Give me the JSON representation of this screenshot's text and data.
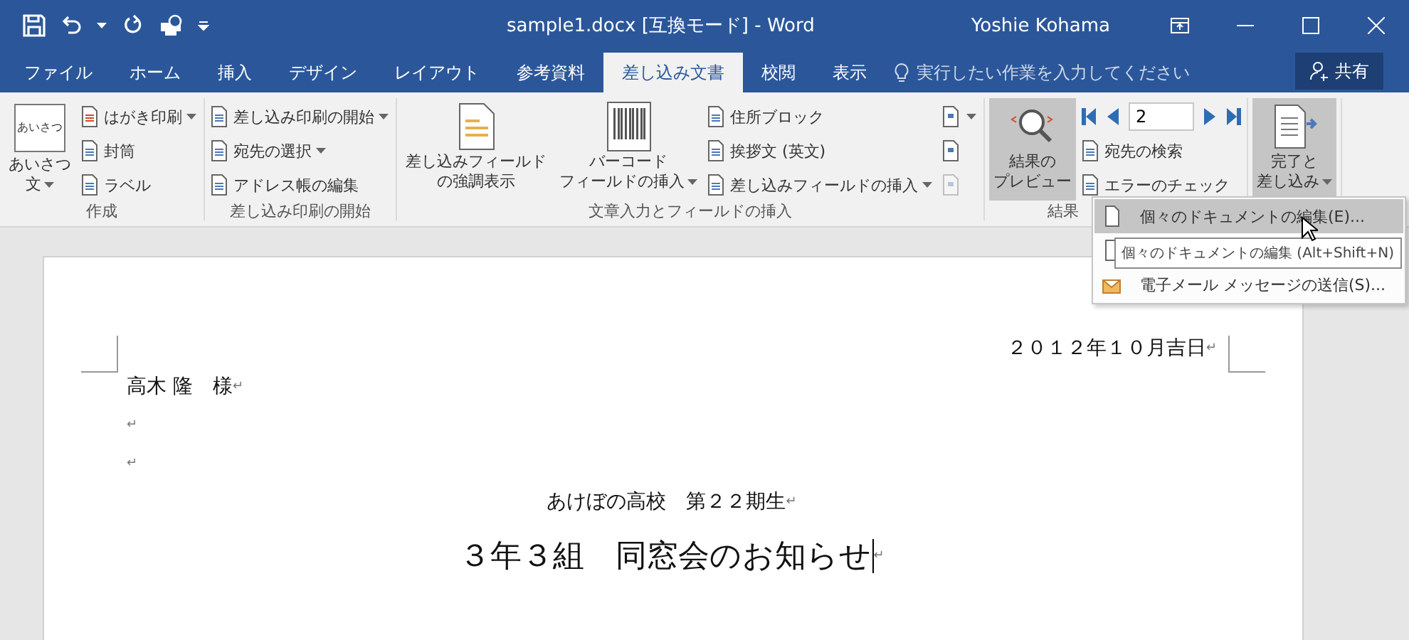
{
  "window": {
    "title": "sample1.docx [互換モード] - Word",
    "user": "Yoshie Kohama"
  },
  "quick_access": [
    {
      "kind": "save"
    },
    {
      "kind": "undo",
      "dropdown": true
    },
    {
      "kind": "redo"
    },
    {
      "kind": "touch"
    },
    {
      "kind": "customize"
    }
  ],
  "tabs": [
    {
      "label": "ファイル",
      "selected": false
    },
    {
      "label": "ホーム",
      "selected": false
    },
    {
      "label": "挿入",
      "selected": false
    },
    {
      "label": "デザイン",
      "selected": false
    },
    {
      "label": "レイアウト",
      "selected": false
    },
    {
      "label": "参考資料",
      "selected": false
    },
    {
      "label": "差し込み文書",
      "selected": true
    },
    {
      "label": "校閲",
      "selected": false
    },
    {
      "label": "表示",
      "selected": false
    }
  ],
  "tell_me": {
    "placeholder": "実行したい作業を入力してください"
  },
  "share": "共有",
  "ribbon": {
    "groups": [
      {
        "label": "作成",
        "items": [
          {
            "kind": "large",
            "icon_text": "あいさつ",
            "lines": [
              "あいさつ",
              "文"
            ],
            "dropdown": true,
            "highlighted": false
          },
          {
            "kind": "stack",
            "items": [
              {
                "label": "はがき印刷",
                "dropdown": true
              },
              {
                "label": "封筒",
                "dropdown": false
              },
              {
                "label": "ラベル",
                "dropdown": false
              }
            ]
          }
        ]
      },
      {
        "label": "差し込み印刷の開始",
        "items": [
          {
            "kind": "stack",
            "items": [
              {
                "label": "差し込み印刷の開始",
                "dropdown": true
              },
              {
                "label": "宛先の選択",
                "dropdown": true
              },
              {
                "label": "アドレス帳の編集",
                "dropdown": false
              }
            ]
          }
        ]
      },
      {
        "label": "文章入力とフィールドの挿入",
        "items": [
          {
            "kind": "large",
            "lines": [
              "差し込みフィールド",
              "の強調表示"
            ],
            "dropdown": false,
            "highlighted": false
          },
          {
            "kind": "large",
            "lines": [
              "バーコード",
              "フィールドの挿入"
            ],
            "dropdown": true,
            "highlighted": false
          },
          {
            "kind": "stack",
            "items": [
              {
                "label": "住所ブロック",
                "dropdown": false
              },
              {
                "label": "挨拶文 (英文)",
                "dropdown": false
              },
              {
                "label": "差し込みフィールドの挿入",
                "dropdown": true
              }
            ]
          },
          {
            "kind": "icons",
            "items": [
              {
                "dropdown": true,
                "disabled": false
              },
              {
                "dropdown": false,
                "disabled": false
              },
              {
                "dropdown": false,
                "disabled": true
              }
            ]
          }
        ]
      },
      {
        "label": "結果",
        "items": [
          {
            "kind": "large",
            "lines": [
              "結果の",
              "プレビュー"
            ],
            "dropdown": false,
            "highlighted": true
          },
          {
            "kind": "nav",
            "value": "2",
            "items": [
              {
                "label": "宛先の検索",
                "dropdown": false
              },
              {
                "label": "エラーのチェック",
                "dropdown": false
              }
            ]
          }
        ]
      },
      {
        "items": [
          {
            "kind": "large",
            "lines": [
              "完了と",
              "差し込み"
            ],
            "dropdown": true,
            "highlighted": true
          }
        ]
      }
    ]
  },
  "menu": {
    "items": [
      {
        "kind": "edit",
        "label": "個々のドキュメントの編集(E)...",
        "selected": true
      },
      {
        "kind": "print",
        "selected": false
      },
      {
        "kind": "mail",
        "label": "電子メール メッセージの送信(S)...",
        "selected": false
      }
    ]
  },
  "tooltip": "個々のドキュメントの編集 (Alt+Shift+N)",
  "document": {
    "paragraphs": [
      {
        "kind": "date",
        "text": "２０１２年１０月吉日",
        "mark": "↵",
        "cursor": false
      },
      {
        "kind": "addressee",
        "text": "高木 隆　様",
        "mark": "↵",
        "cursor": false
      },
      {
        "kind": "blank",
        "mark": "↵",
        "cursor": false
      },
      {
        "kind": "blank",
        "mark": "↵",
        "cursor": false
      },
      {
        "kind": "subtitle",
        "text": "あけぼの高校　第２２期生",
        "mark": "↵",
        "cursor": false
      },
      {
        "kind": "title",
        "text": "３年３組　同窓会のお知らせ",
        "mark": "↵",
        "cursor": true
      }
    ]
  }
}
